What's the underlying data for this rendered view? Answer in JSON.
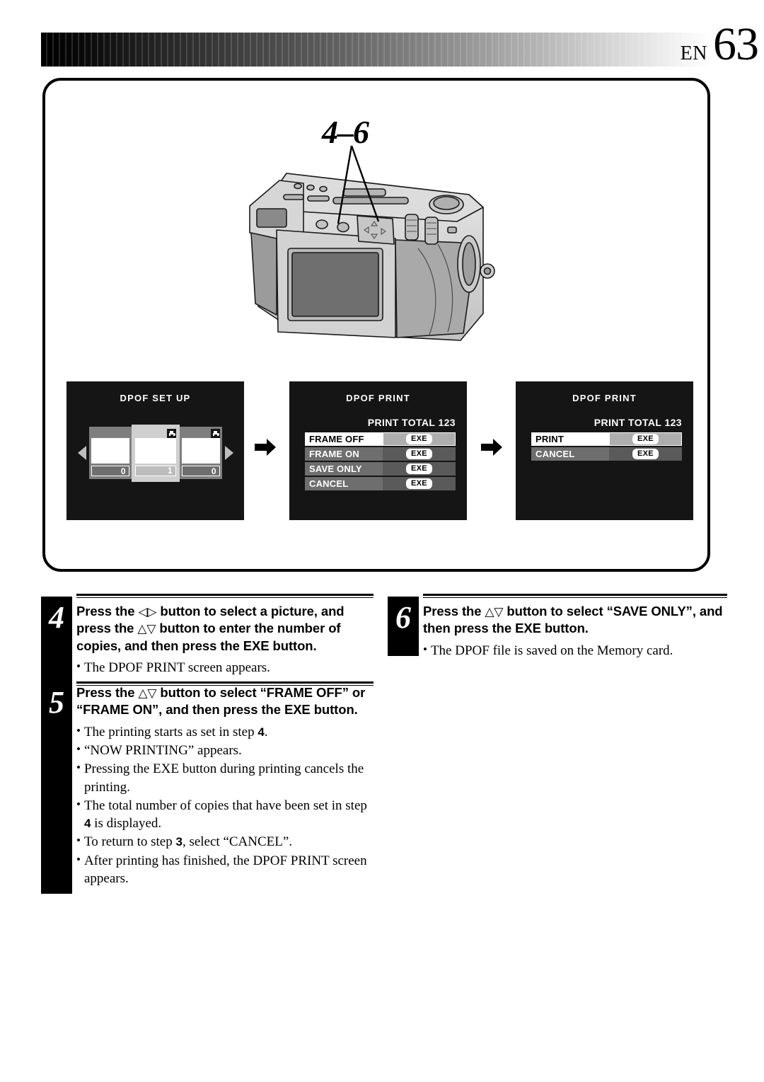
{
  "header": {
    "language_code": "EN",
    "page_number": "63"
  },
  "illustration": {
    "step_range_label": "4–6",
    "camera_caption_icon": "camera-rear-view",
    "callout_targets": [
      "exe-button",
      "four-way-pad"
    ]
  },
  "screens": [
    {
      "id": "dpof-set-up",
      "title": "DPOF SET UP",
      "type": "thumbnails",
      "nav_left": "◀",
      "nav_right": "▶",
      "thumbnails": [
        {
          "count": "0",
          "selected": false,
          "printer_icon": false
        },
        {
          "count": "1",
          "selected": true,
          "printer_icon": true
        },
        {
          "count": "0",
          "selected": false,
          "printer_icon": true
        }
      ]
    },
    {
      "id": "dpof-print-frame",
      "title": "DPOF PRINT",
      "type": "menu",
      "print_total_label": "PRINT TOTAL",
      "print_total_value": "123",
      "rows": [
        {
          "label": "FRAME OFF",
          "exe": "EXE",
          "selected": true
        },
        {
          "label": "FRAME ON",
          "exe": "EXE",
          "selected": false
        },
        {
          "label": "SAVE ONLY",
          "exe": "EXE",
          "selected": false
        },
        {
          "label": "CANCEL",
          "exe": "EXE",
          "selected": false
        }
      ]
    },
    {
      "id": "dpof-print-confirm",
      "title": "DPOF PRINT",
      "type": "menu",
      "print_total_label": "PRINT TOTAL",
      "print_total_value": "123",
      "rows": [
        {
          "label": "PRINT",
          "exe": "EXE",
          "selected": true
        },
        {
          "label": "CANCEL",
          "exe": "EXE",
          "selected": false
        }
      ]
    }
  ],
  "flow_arrows": [
    "arrow-right-icon",
    "arrow-right-icon"
  ],
  "steps": [
    {
      "number": "4",
      "heading_part1": "Press the ",
      "glyph1": "◁▷",
      "heading_part2": " button to select a picture, and press the ",
      "glyph2": "△▽",
      "heading_part3": " button to enter the number of copies, and then press the EXE button.",
      "bullets": [
        {
          "text": "The DPOF PRINT screen appears."
        }
      ]
    },
    {
      "number": "5",
      "heading_part1": "Press the ",
      "glyph1": "△▽",
      "heading_part2": " button to select “FRAME OFF” or “FRAME ON”, and then press the EXE button.",
      "bullets": [
        {
          "pre": "The printing starts as set in step ",
          "strong": "4",
          "post": "."
        },
        {
          "text": "“NOW PRINTING” appears."
        },
        {
          "text": "Pressing the EXE button during printing cancels the printing."
        },
        {
          "pre": "The total number of copies that have been set in step ",
          "strong": "4",
          "post": " is displayed."
        },
        {
          "pre": "To return to step ",
          "strong": "3",
          "post": ", select “CANCEL”."
        },
        {
          "text": "After printing has finished, the DPOF PRINT screen appears."
        }
      ]
    },
    {
      "number": "6",
      "heading_part1": "Press the ",
      "glyph1": "△▽",
      "heading_part2": " button to select “SAVE ONLY”, and then press the EXE button.",
      "bullets": [
        {
          "text": "The DPOF file is saved on the Memory card."
        }
      ]
    }
  ],
  "colors": {
    "screen_bg": "#151515",
    "row_bg": "#6e6e6e",
    "row_selected_bg": "#ffffff",
    "exe_panel_bg": "#5a5a5a",
    "exe_panel_selected_bg": "#aeaeae"
  }
}
